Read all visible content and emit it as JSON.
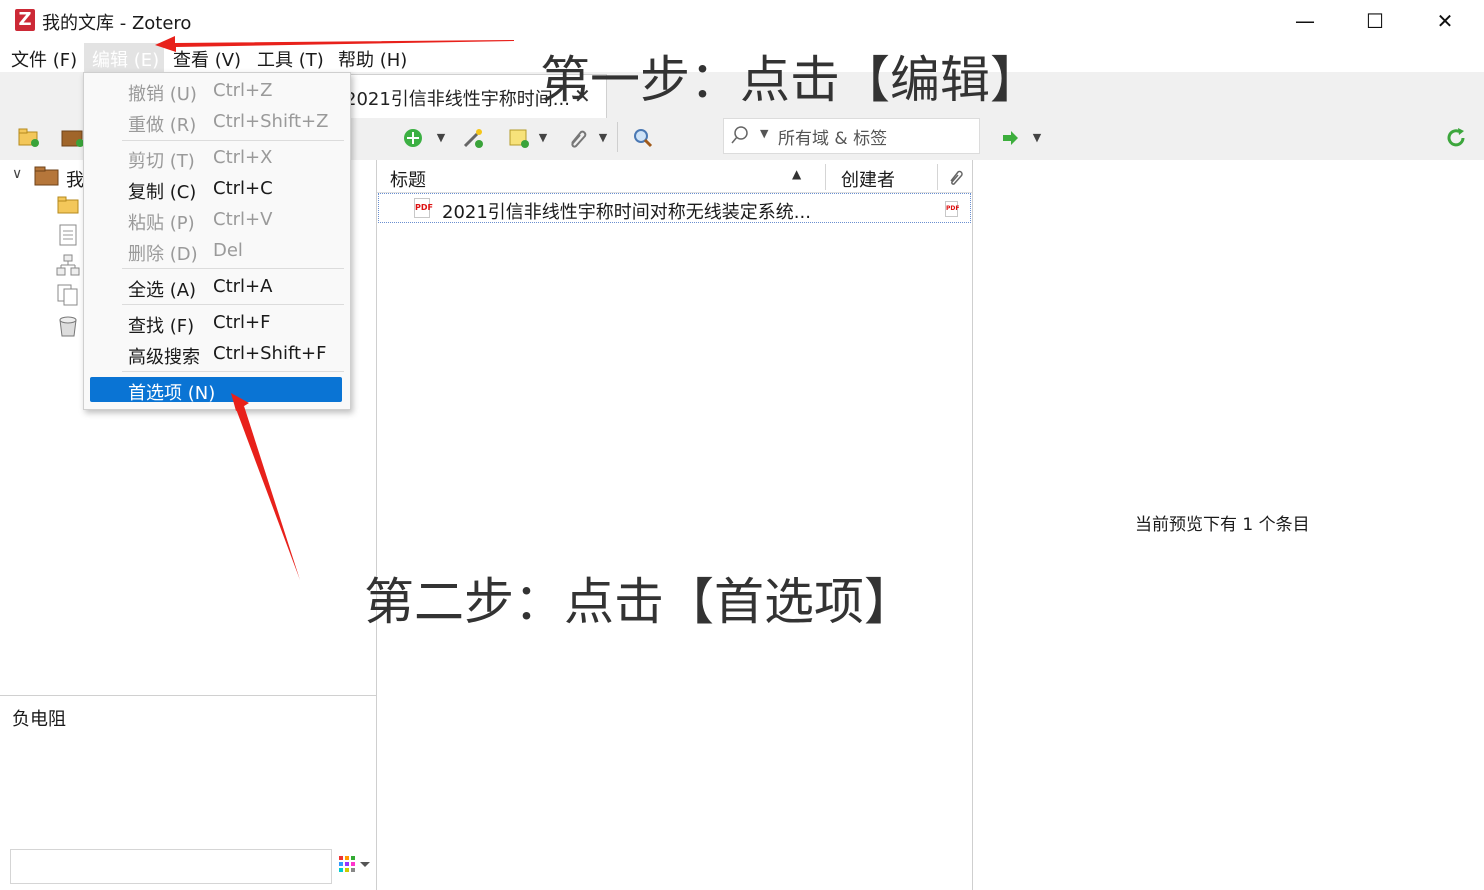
{
  "window": {
    "title": "我的文库 - Zotero",
    "logo": "Z",
    "controls": {
      "minimize": "—",
      "maximize": "☐",
      "close": "✕"
    }
  },
  "menubar": {
    "file": "文件 (F)",
    "edit": "编辑 (E)",
    "view": "查看 (V)",
    "tools": "工具 (T)",
    "help": "帮助 (H)"
  },
  "tab": {
    "title": "2021引信非线性宇称时间...",
    "close": "✕"
  },
  "search": {
    "scope": "所有域 & 标签"
  },
  "collections": {
    "root_label": "我"
  },
  "tag_selector": {
    "label": "负电阻"
  },
  "items": {
    "columns": {
      "title": "标题",
      "creator": "创建者"
    },
    "rows": [
      {
        "title": "2021引信非线性宇称时间对称无线装定系统..."
      }
    ]
  },
  "preview": {
    "text": "当前预览下有 1 个条目"
  },
  "edit_menu": {
    "undo": {
      "label": "撤销 (U)",
      "shortcut": "Ctrl+Z"
    },
    "redo": {
      "label": "重做 (R)",
      "shortcut": "Ctrl+Shift+Z"
    },
    "cut": {
      "label": "剪切 (T)",
      "shortcut": "Ctrl+X"
    },
    "copy": {
      "label": "复制 (C)",
      "shortcut": "Ctrl+C"
    },
    "paste": {
      "label": "粘贴 (P)",
      "shortcut": "Ctrl+V"
    },
    "delete": {
      "label": "删除 (D)",
      "shortcut": "Del"
    },
    "select_all": {
      "label": "全选 (A)",
      "shortcut": "Ctrl+A"
    },
    "find": {
      "label": "查找 (F)",
      "shortcut": "Ctrl+F"
    },
    "advanced_search": {
      "label": "高级搜索",
      "shortcut": "Ctrl+Shift+F"
    },
    "preferences": {
      "label": "首选项 (N)"
    }
  },
  "annotations": {
    "step1": "第一步：点击【编辑】",
    "step2": "第二步：点击【首选项】",
    "arrow_color": "#e8211b"
  },
  "colors": {
    "highlight": "#0a74d4",
    "brand": "#cc2936"
  }
}
